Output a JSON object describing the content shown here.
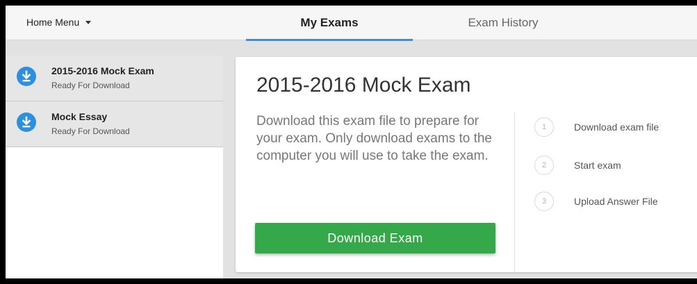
{
  "header": {
    "home_menu": "Home Menu",
    "tabs": [
      {
        "label": "My Exams",
        "active": true
      },
      {
        "label": "Exam History",
        "active": false
      }
    ],
    "accent_color": "#3d8fdc"
  },
  "sidebar": {
    "items": [
      {
        "title": "2015-2016 Mock Exam",
        "status": "Ready For Download",
        "icon": "download-icon"
      },
      {
        "title": "Mock Essay",
        "status": "Ready For Download",
        "icon": "download-icon"
      }
    ]
  },
  "main": {
    "title": "2015-2016 Mock Exam",
    "description": "Download this exam file to prepare for your exam. Only download exams to the computer you will use to take the exam.",
    "button_label": "Download Exam",
    "button_color": "#35a84a",
    "steps": [
      {
        "number": "1",
        "label": "Download exam file"
      },
      {
        "number": "2",
        "label": "Start exam"
      },
      {
        "number": "3",
        "label": "Upload Answer File"
      }
    ]
  }
}
